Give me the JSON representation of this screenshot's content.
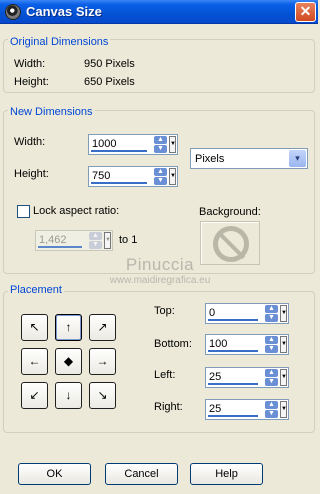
{
  "window": {
    "title": "Canvas Size",
    "close_glyph": "✕"
  },
  "original": {
    "legend": "Original Dimensions",
    "width_label": "Width:",
    "width_value": "950 Pixels",
    "height_label": "Height:",
    "height_value": "650 Pixels"
  },
  "new_dims": {
    "legend": "New Dimensions",
    "width_label": "Width:",
    "width_value": "1000",
    "height_label": "Height:",
    "height_value": "750",
    "units_selected": "Pixels",
    "lock_label": "Lock aspect ratio:",
    "lock_checked": false,
    "ratio_value": "1,462",
    "ratio_suffix": "to 1",
    "background_label": "Background:"
  },
  "watermark": {
    "line1": "Pinuccia",
    "line2": "www.maidiregrafica.eu"
  },
  "placement": {
    "legend": "Placement",
    "anchors": [
      {
        "glyph": "↖",
        "name": "top-left"
      },
      {
        "glyph": "↑",
        "name": "top-center"
      },
      {
        "glyph": "↗",
        "name": "top-right"
      },
      {
        "glyph": "←",
        "name": "middle-left"
      },
      {
        "glyph": "◆",
        "name": "center"
      },
      {
        "glyph": "→",
        "name": "middle-right"
      },
      {
        "glyph": "↙",
        "name": "bottom-left"
      },
      {
        "glyph": "↓",
        "name": "bottom-center"
      },
      {
        "glyph": "↘",
        "name": "bottom-right"
      }
    ],
    "selected_anchor": "top-center",
    "top_label": "Top:",
    "top_value": "0",
    "bottom_label": "Bottom:",
    "bottom_value": "100",
    "left_label": "Left:",
    "left_value": "25",
    "right_label": "Right:",
    "right_value": "25"
  },
  "buttons": {
    "ok": "OK",
    "cancel": "Cancel",
    "help": "Help"
  },
  "icons": {
    "up": "▲",
    "down": "▼",
    "small_down": "▼",
    "dropdown": "▾"
  }
}
